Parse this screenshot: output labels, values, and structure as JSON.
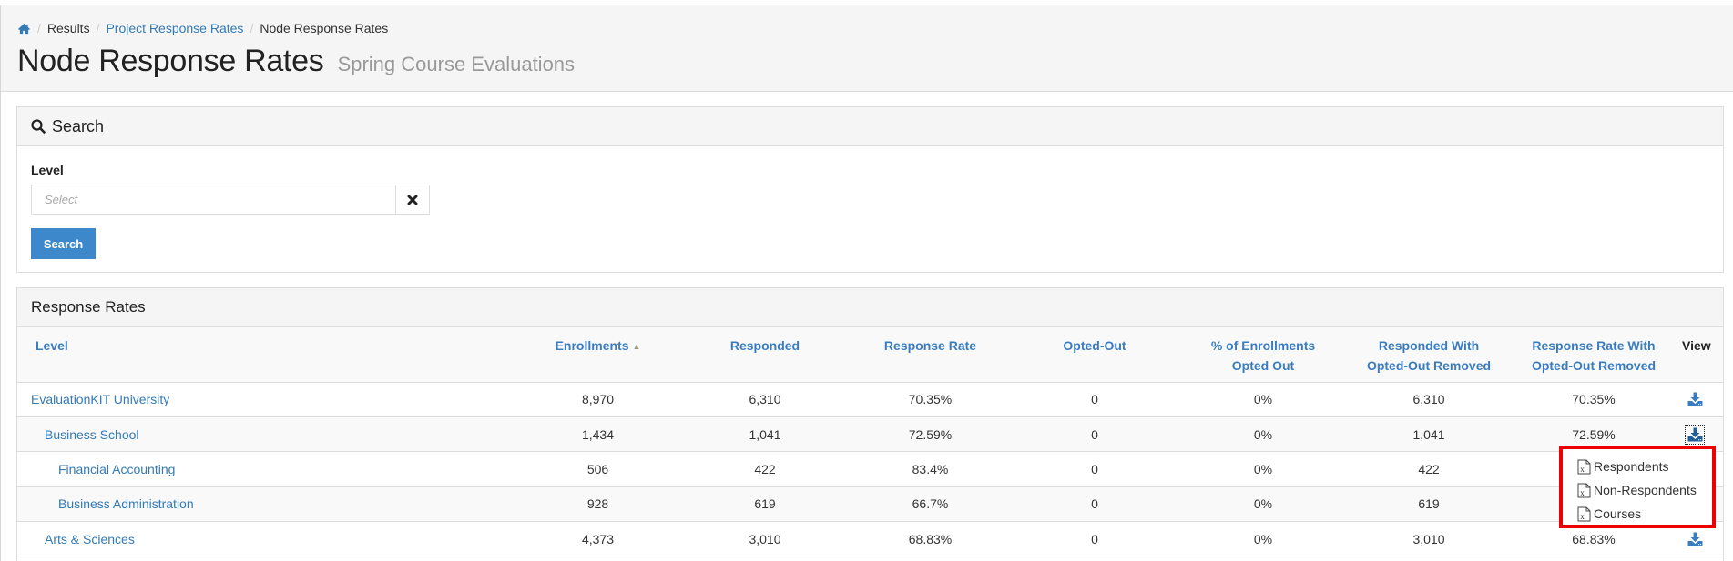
{
  "breadcrumb": {
    "home_icon": "home-icon",
    "items": [
      {
        "label": "Results",
        "link": false
      },
      {
        "label": "Project Response Rates",
        "link": true
      },
      {
        "label": "Node Response Rates",
        "link": false
      }
    ]
  },
  "header": {
    "title": "Node Response Rates",
    "subtitle": "Spring Course Evaluations"
  },
  "search_panel": {
    "title": "Search",
    "icon": "search-icon",
    "level_label": "Level",
    "level_placeholder": "Select",
    "level_value": "",
    "clear_icon": "close-icon",
    "search_button": "Search"
  },
  "rates_panel": {
    "title": "Response Rates",
    "columns": [
      "Level",
      "Enrollments",
      "Responded",
      "Response Rate",
      "Opted-Out",
      "% of Enrollments Opted Out",
      "Responded With Opted-Out Removed",
      "Response Rate With Opted-Out Removed",
      "View"
    ],
    "sorted_column": "Enrollments",
    "sort_direction": "ascending",
    "rows": [
      {
        "level": "EvaluationKIT University",
        "depth": 0,
        "enrollments": "8,970",
        "responded": "6,310",
        "response_rate": "70.35%",
        "opted_out": "0",
        "pct_opted_out": "0%",
        "responded_wo": "6,310",
        "rate_wo": "70.35%"
      },
      {
        "level": "Business School",
        "depth": 1,
        "enrollments": "1,434",
        "responded": "1,041",
        "response_rate": "72.59%",
        "opted_out": "0",
        "pct_opted_out": "0%",
        "responded_wo": "1,041",
        "rate_wo": "72.59%"
      },
      {
        "level": "Financial Accounting",
        "depth": 2,
        "enrollments": "506",
        "responded": "422",
        "response_rate": "83.4%",
        "opted_out": "0",
        "pct_opted_out": "0%",
        "responded_wo": "422",
        "rate_wo": ""
      },
      {
        "level": "Business Administration",
        "depth": 2,
        "enrollments": "928",
        "responded": "619",
        "response_rate": "66.7%",
        "opted_out": "0",
        "pct_opted_out": "0%",
        "responded_wo": "619",
        "rate_wo": ""
      },
      {
        "level": "Arts & Sciences",
        "depth": 1,
        "enrollments": "4,373",
        "responded": "3,010",
        "response_rate": "68.83%",
        "opted_out": "0",
        "pct_opted_out": "0%",
        "responded_wo": "3,010",
        "rate_wo": "68.83%"
      }
    ]
  },
  "export_menu": {
    "open_for_row": 1,
    "items": [
      {
        "label": "Respondents",
        "icon": "excel-file-icon"
      },
      {
        "label": "Non-Respondents",
        "icon": "excel-file-icon"
      },
      {
        "label": "Courses",
        "icon": "excel-file-icon"
      }
    ]
  },
  "colors": {
    "link": "#337ab7",
    "header_link": "#3a7cc0",
    "primary_button": "#3d88cb",
    "highlight_border": "#ee0000"
  }
}
